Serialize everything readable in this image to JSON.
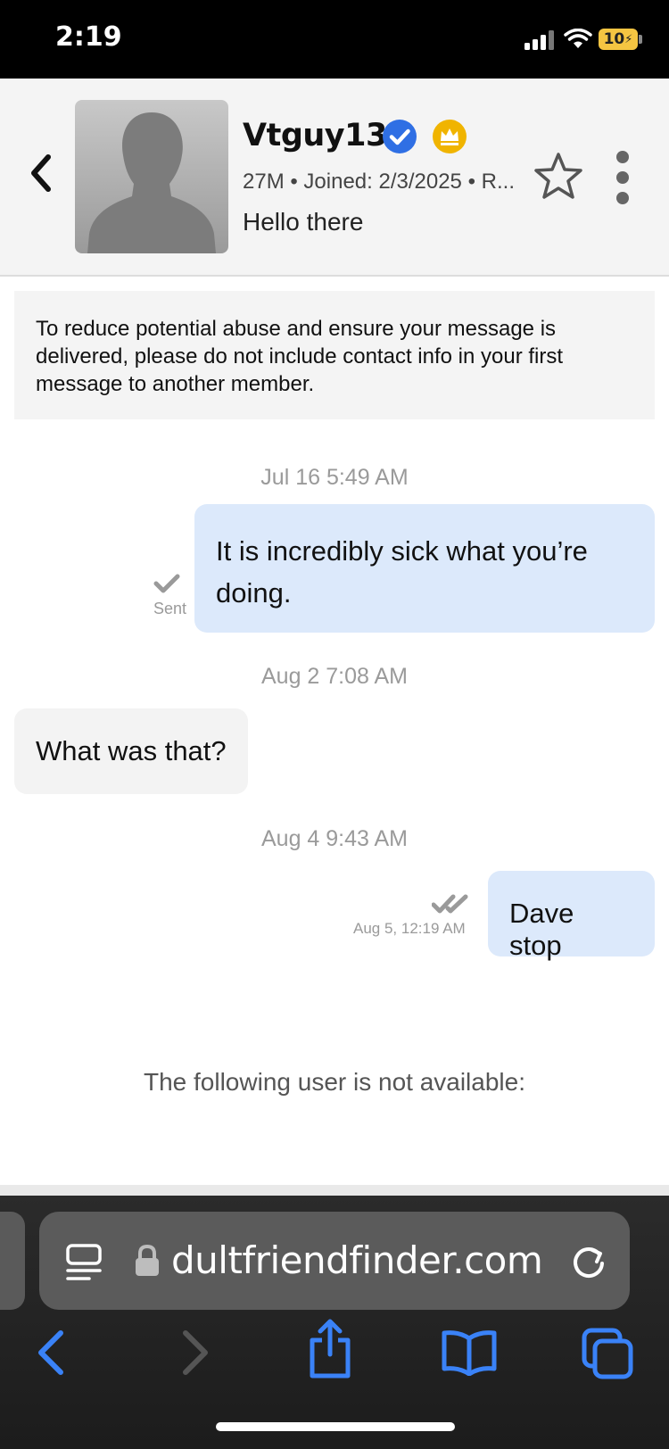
{
  "status_bar": {
    "time": "2:19",
    "battery": "10"
  },
  "header": {
    "name": "Vtguy13",
    "meta": "27M • Joined: 2/3/2025 • R...",
    "status": "Hello there"
  },
  "notice": "To reduce potential abuse and ensure your message is delivered, please do not include contact info in your first message to another member.",
  "messages": [
    {
      "timestamp": "Jul 16 5:49 AM",
      "text": "It is incredibly sick what you’re doing.",
      "receipt": "Sent"
    },
    {
      "timestamp": "Aug 2 7:08 AM",
      "text": "What was that?"
    },
    {
      "timestamp": "Aug 4 9:43 AM",
      "text": "Dave stop",
      "receipt": "Aug 5, 12:19 AM"
    }
  ],
  "unavailable_text": "The following user is not available:",
  "browser": {
    "url": "dultfriendfinder.com"
  },
  "colors": {
    "outgoing_bubble": "#dce9fb",
    "incoming_bubble": "#f3f3f3",
    "accent": "#3a82f7",
    "crown": "#f0b400"
  },
  "icons": [
    "back-chevron-icon",
    "verified-icon",
    "crown-icon",
    "star-icon",
    "more-vertical-icon",
    "checkmark-icon",
    "double-checkmark-icon",
    "reader-icon",
    "lock-icon",
    "reload-icon",
    "nav-back-icon",
    "nav-forward-icon",
    "share-icon",
    "bookmarks-icon",
    "tabs-icon"
  ]
}
